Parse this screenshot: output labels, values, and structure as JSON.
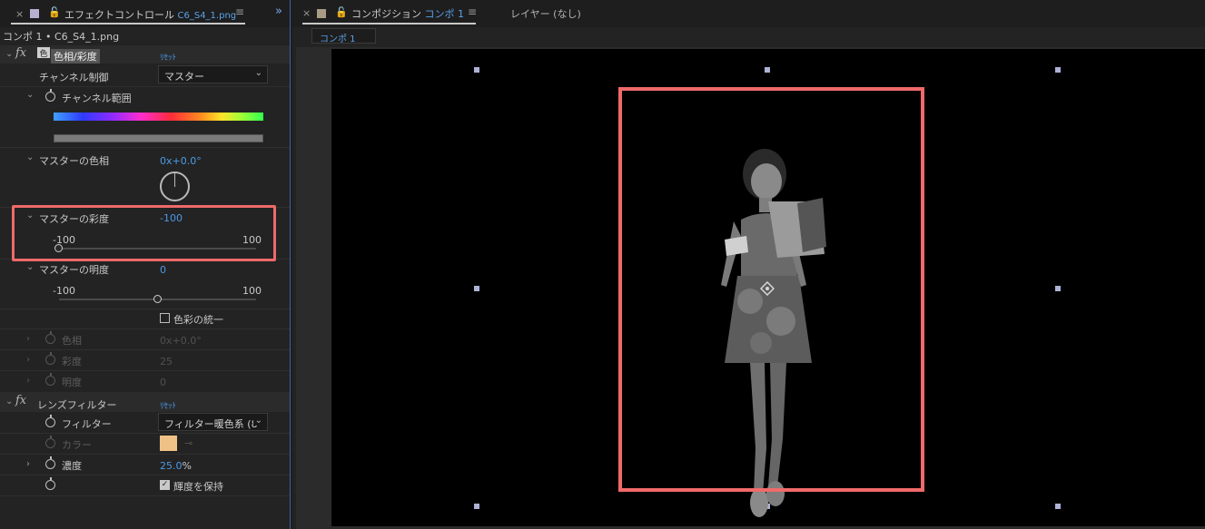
{
  "effect_panel": {
    "tab_close": "×",
    "tab_title": "エフェクトコントロール",
    "tab_file": "C6_S4_1.png",
    "tab_menu": "≡",
    "expand": "»",
    "breadcrumb": "コンポ 1 • C6_S4_1.png",
    "hue_sat": {
      "name": "色相/彩度",
      "reset": "ﾘｾｯﾄ",
      "channel_control_label": "チャンネル制御",
      "channel_control_value": "マスター",
      "channel_range_label": "チャンネル範囲",
      "master_hue_label": "マスターの色相",
      "master_hue_value": "0x+0.0°",
      "master_sat_label": "マスターの彩度",
      "master_sat_value": "-100",
      "master_sat_min": "-100",
      "master_sat_max": "100",
      "master_sat_level": -100,
      "master_light_label": "マスターの明度",
      "master_light_value": "0",
      "master_light_min": "-100",
      "master_light_max": "100",
      "master_light_level": 0,
      "colorize_label": "色彩の統一",
      "colorize_checked": false,
      "hue_label": "色相",
      "hue_value": "0x+0.0°",
      "sat_label": "彩度",
      "sat_value": "25",
      "light_label": "明度",
      "light_value": "0"
    },
    "lens_filter": {
      "name": "レンズフィルター",
      "reset": "ﾘｾｯﾄ",
      "filter_label": "フィルター",
      "filter_value": "フィルター暖色系 (8",
      "color_label": "カラー",
      "color_value": "#f0c187",
      "density_label": "濃度",
      "density_value": "25.0",
      "density_unit": "%",
      "preserve_label": "輝度を保持",
      "preserve_checked": true
    }
  },
  "comp_panel": {
    "tab_close": "×",
    "tab_title": "コンポジション",
    "tab_comp": "コンポ 1",
    "tab_menu": "≡",
    "layer_label": "レイヤー (なし)",
    "comp_chip": "コンポ 1"
  },
  "colors": {
    "accent": "#4c9ae8",
    "highlight": "#f06a6a",
    "panel_bg": "#232323"
  }
}
